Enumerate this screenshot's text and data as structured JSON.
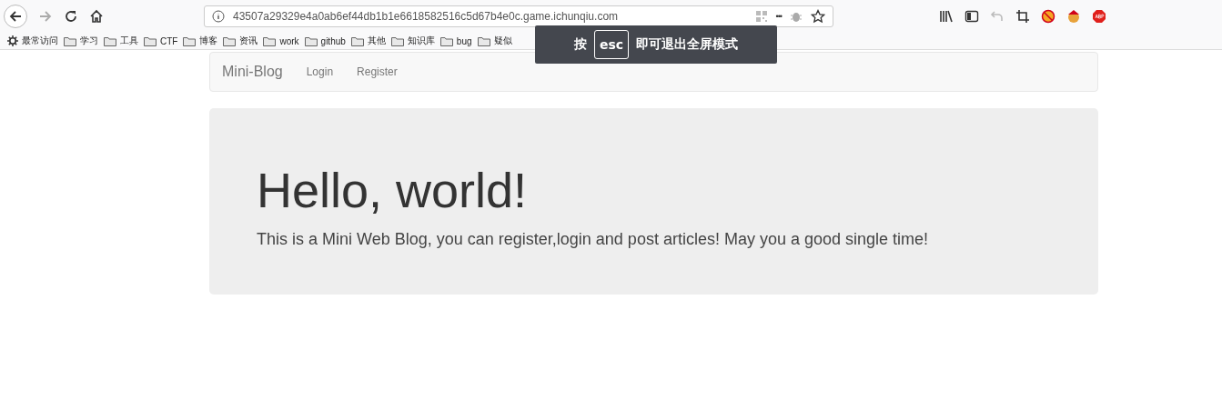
{
  "browser": {
    "url": "43507a29329e4a0ab6ef44db1b1e6618582516c5d67b4e0c.game.ichunqiu.com",
    "more_button": "•••"
  },
  "bookmarks": [
    {
      "kind": "gear",
      "label": "最常访问"
    },
    {
      "kind": "folder",
      "label": "学习"
    },
    {
      "kind": "folder",
      "label": "工具"
    },
    {
      "kind": "folder",
      "label": "CTF"
    },
    {
      "kind": "folder",
      "label": "博客"
    },
    {
      "kind": "folder",
      "label": "资讯"
    },
    {
      "kind": "folder",
      "label": "work"
    },
    {
      "kind": "folder",
      "label": "github"
    },
    {
      "kind": "folder",
      "label": "其他"
    },
    {
      "kind": "folder",
      "label": "知识库"
    },
    {
      "kind": "folder",
      "label": "bug"
    },
    {
      "kind": "folder",
      "label": "疑似"
    }
  ],
  "fullscreen_notice": {
    "before": "按",
    "key": "esc",
    "after": "即可退出全屏模式"
  },
  "navbar": {
    "brand": "Mini-Blog",
    "links": [
      "Login",
      "Register"
    ]
  },
  "jumbotron": {
    "heading": "Hello, world!",
    "text": "This is a Mini Web Blog, you can register,login and post articles! May you a good single time!"
  }
}
